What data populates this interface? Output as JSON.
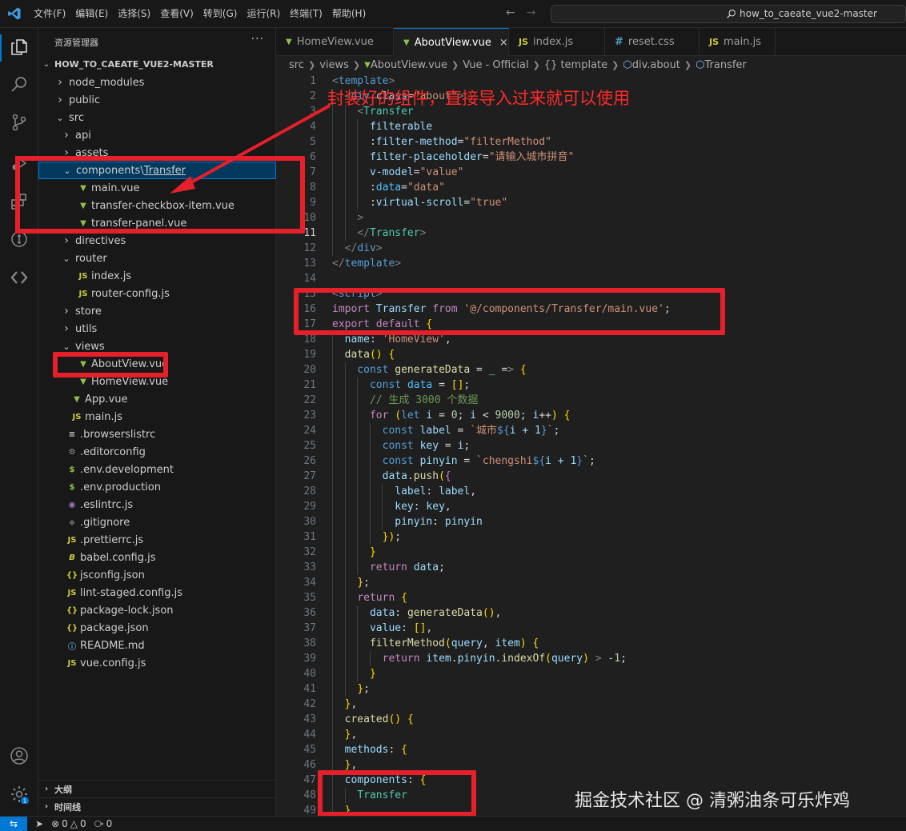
{
  "menu": [
    "文件(F)",
    "编辑(E)",
    "选择(S)",
    "查看(V)",
    "转到(G)",
    "运行(R)",
    "终端(T)",
    "帮助(H)"
  ],
  "search": {
    "text": "how_to_caeate_vue2-master"
  },
  "sidebar": {
    "header": "资源管理器",
    "more": "···",
    "project": "HOW_TO_CAEATE_VUE2-MASTER",
    "tree": [
      {
        "label": "node_modules",
        "kind": "folder",
        "open": false
      },
      {
        "label": "public",
        "kind": "folder",
        "open": false
      },
      {
        "label": "src",
        "kind": "folder",
        "open": true
      },
      {
        "label": "api",
        "kind": "folder",
        "open": false
      },
      {
        "label": "assets",
        "kind": "folder",
        "open": false
      },
      {
        "label": "components",
        "kind": "folder",
        "open": true,
        "extra": "Transfer"
      },
      {
        "label": "main.vue",
        "kind": "vue"
      },
      {
        "label": "transfer-checkbox-item.vue",
        "kind": "vue"
      },
      {
        "label": "transfer-panel.vue",
        "kind": "vue"
      },
      {
        "label": "directives",
        "kind": "folder",
        "open": false
      },
      {
        "label": "router",
        "kind": "folder",
        "open": true
      },
      {
        "label": "index.js",
        "kind": "js"
      },
      {
        "label": "router-config.js",
        "kind": "js"
      },
      {
        "label": "store",
        "kind": "folder",
        "open": false
      },
      {
        "label": "utils",
        "kind": "folder",
        "open": false
      },
      {
        "label": "views",
        "kind": "folder",
        "open": true
      },
      {
        "label": "AboutView.vue",
        "kind": "vue"
      },
      {
        "label": "HomeView.vue",
        "kind": "vue"
      },
      {
        "label": "App.vue",
        "kind": "vue"
      },
      {
        "label": "main.js",
        "kind": "js"
      },
      {
        "label": ".browserslistrc",
        "kind": "browsers"
      },
      {
        "label": ".editorconfig",
        "kind": "gear"
      },
      {
        "label": ".env.development",
        "kind": "dollar"
      },
      {
        "label": ".env.production",
        "kind": "dollar"
      },
      {
        "label": ".eslintrc.js",
        "kind": "eslint"
      },
      {
        "label": ".gitignore",
        "kind": "git"
      },
      {
        "label": ".prettierrc.js",
        "kind": "js"
      },
      {
        "label": "babel.config.js",
        "kind": "babel"
      },
      {
        "label": "jsconfig.json",
        "kind": "json"
      },
      {
        "label": "lint-staged.config.js",
        "kind": "js"
      },
      {
        "label": "package-lock.json",
        "kind": "json"
      },
      {
        "label": "package.json",
        "kind": "json"
      },
      {
        "label": "README.md",
        "kind": "info"
      },
      {
        "label": "vue.config.js",
        "kind": "js"
      }
    ],
    "outline": "大纲",
    "timeline": "时间线"
  },
  "tabs": [
    {
      "label": "HomeView.vue",
      "icon": "vue",
      "active": false
    },
    {
      "label": "AboutView.vue",
      "icon": "vue",
      "active": true
    },
    {
      "label": "index.js",
      "icon": "js",
      "active": false
    },
    {
      "label": "reset.css",
      "icon": "css",
      "active": false
    },
    {
      "label": "main.js",
      "icon": "js",
      "active": false
    }
  ],
  "breadcrumbs": [
    "src",
    "views",
    "AboutView.vue",
    "Vue - Official",
    "{} template",
    "div.about",
    "Transfer"
  ],
  "code": {
    "start_line": 1,
    "current_line": 11,
    "lines": [
      "<template>",
      "  <div class=\"about\">",
      "    <Transfer",
      "      filterable",
      "      :filter-method=\"filterMethod\"",
      "      filter-placeholder=\"请输入城市拼音\"",
      "      v-model=\"value\"",
      "      :data=\"data\"",
      "      :virtual-scroll=\"true\"",
      "    >",
      "    </Transfer>",
      "  </div>",
      "</template>",
      "",
      "<script>",
      "import Transfer from '@/components/Transfer/main.vue';",
      "export default {",
      "  name: 'HomeView',",
      "  data() {",
      "    const generateData = _ => {",
      "      const data = [];",
      "      // 生成 3000 个数据",
      "      for (let i = 0; i < 9000; i++) {",
      "        const label = `城市${i + 1}`;",
      "        const key = i;",
      "        const pinyin = `chengshi${i + 1}`;",
      "        data.push({",
      "          label: label,",
      "          key: key,",
      "          pinyin: pinyin",
      "        });",
      "      }",
      "      return data;",
      "    };",
      "    return {",
      "      data: generateData(),",
      "      value: [],",
      "      filterMethod(query, item) {",
      "        return item.pinyin.indexOf(query) > -1;",
      "      }",
      "    };",
      "  },",
      "  created() {",
      "  },",
      "  methods: {",
      "  },",
      "  components: {",
      "    Transfer",
      "  }"
    ]
  },
  "annotation": {
    "text": "封装好的组件，直接导入过来就可以使用",
    "color": "#e5202a"
  },
  "watermark": "掘金技术社区 @ 清粥油条可乐炸鸡",
  "status": {
    "errors": "0",
    "warnings": "0",
    "ports": "0"
  }
}
